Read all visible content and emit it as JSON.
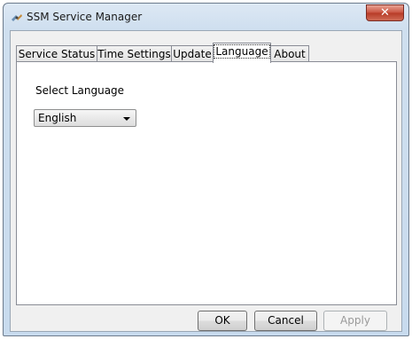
{
  "window": {
    "title": "SSM Service Manager",
    "close_glyph": "✕"
  },
  "tabs": [
    {
      "label": "Service Status",
      "active": false
    },
    {
      "label": "Time Settings",
      "active": false
    },
    {
      "label": "Update",
      "active": false
    },
    {
      "label": "Language",
      "active": true
    },
    {
      "label": "About",
      "active": false
    }
  ],
  "language_panel": {
    "label": "Select Language",
    "selected": "English"
  },
  "buttons": {
    "ok": "OK",
    "cancel": "Cancel",
    "apply": "Apply"
  },
  "icons": {
    "app": "ssm-app-icon",
    "close": "close-icon",
    "dropdown": "chevron-down-icon"
  },
  "colors": {
    "titlebar": "#cfdfef",
    "close": "#c9523f",
    "panel": "#ffffff",
    "dialog": "#f0f0f0"
  }
}
